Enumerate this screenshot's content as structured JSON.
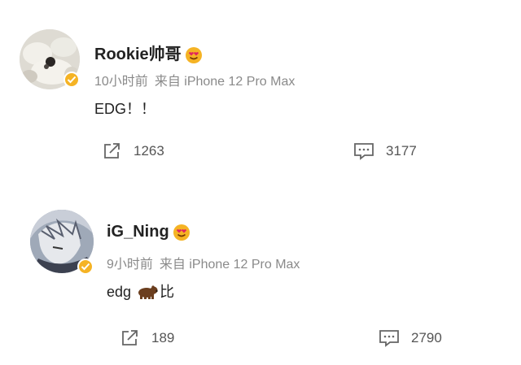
{
  "posts": [
    {
      "username": "Rookie帅哥",
      "badge_icon": "smiling-face-with-heart-eyes-icon",
      "time": "10小时前",
      "source": "来自 iPhone 12 Pro Max",
      "content": "EDG！！",
      "repost_count": "1263",
      "comment_count": "3177"
    },
    {
      "username": "iG_Ning",
      "badge_icon": "smiling-face-with-heart-eyes-icon",
      "time": "9小时前",
      "source": "来自 iPhone 12 Pro Max",
      "content_prefix": "edg",
      "content_emoji": "bear-icon",
      "content_suffix": "比",
      "repost_count": "189",
      "comment_count": "2790"
    }
  ],
  "colors": {
    "verified_badge": "#f5b324",
    "meta_text": "#8a8a8a",
    "name_text": "#222222"
  }
}
